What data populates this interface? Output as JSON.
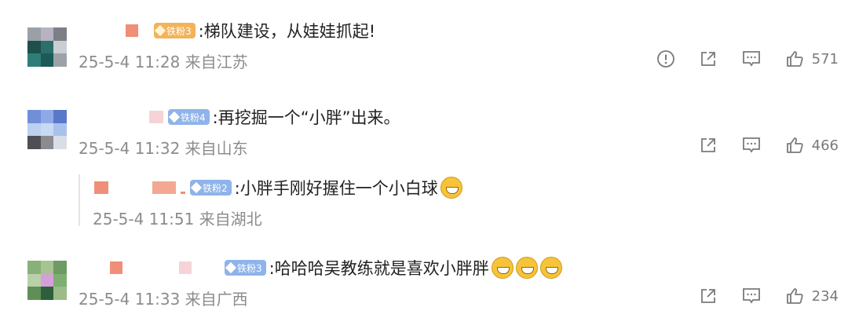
{
  "comments": [
    {
      "badge_label": "铁粉3",
      "text": ":梯队建设，从娃娃抓起!",
      "meta": "25-5-4 11:28 来自江苏",
      "likes": "571",
      "avatar_colors": [
        "#9aa0a8",
        "#b7b2c2",
        "#7c7f86",
        "#1f4f4b",
        "#2c6e6a",
        "#c9ced3",
        "#2f7d79",
        "#1b5a57",
        "#9ca3a8"
      ],
      "badge_color": "#f2b35a"
    },
    {
      "badge_label": "铁粉4",
      "text": ":再挖掘一个“小胖”出来。",
      "meta": "25-5-4 11:32 来自山东",
      "likes": "466",
      "avatar_colors": [
        "#6f8fd8",
        "#8fa9e6",
        "#5a78c8",
        "#bcd0f0",
        "#c8d9f3",
        "#a9c1ee",
        "#4f4f55",
        "#8a8a90",
        "#d9dde5"
      ],
      "badge_color": "#8fb3ea"
    },
    {
      "badge_label": "铁粉3",
      "text": ":哈哈哈吴教练就是喜欢小胖胖",
      "meta": "25-5-4 11:33 来自广西",
      "likes": "234",
      "avatar_colors": [
        "#8ab07a",
        "#a6c48f",
        "#6e9b63",
        "#b9d0a8",
        "#d4a0d8",
        "#7fae71",
        "#5f8f56",
        "#2f5f3a",
        "#9bbb88"
      ],
      "badge_color": "#8fb3ea"
    }
  ],
  "reply": {
    "badge_label": "铁粉2",
    "text": ":小胖手刚好握住一个小白球",
    "meta": "25-5-4 11:51 来自湖北",
    "badge_color": "#8fb3ea"
  },
  "icons": {
    "report": "report-icon",
    "share": "share-icon",
    "comment": "comment-icon",
    "like": "thumbs-up-icon",
    "emoji": "grinning-emoji-icon"
  }
}
